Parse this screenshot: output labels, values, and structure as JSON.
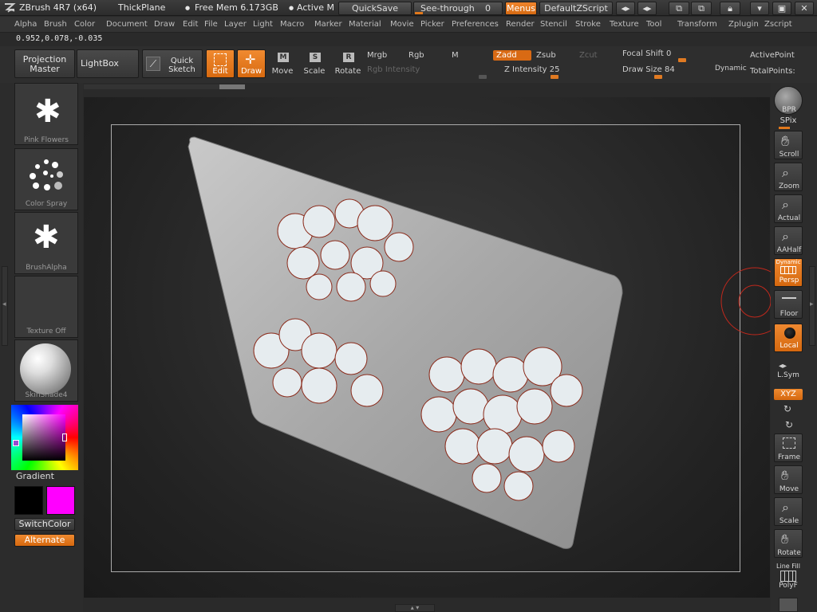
{
  "title": {
    "app": "ZBrush 4R7 (x64)",
    "document": "ThickPlane",
    "mem": "Free Mem 6.173GB",
    "active": "Active M",
    "quicksave": "QuickSave",
    "seethrough": "See-through",
    "seethrough_value": "0",
    "menus": "Menus",
    "zscript": "DefaultZScript"
  },
  "menu": [
    "Alpha",
    "Brush",
    "Color",
    "Document",
    "Draw",
    "Edit",
    "File",
    "Layer",
    "Light",
    "Macro",
    "Marker",
    "Material",
    "Movie",
    "Picker",
    "Preferences",
    "Render",
    "Stencil",
    "Stroke",
    "Texture",
    "Tool",
    "Transform",
    "Zplugin",
    "Zscript"
  ],
  "coords": "0.952,0.078,-0.035",
  "toolbar": {
    "projection_master": "Projection Master",
    "lightbox": "LightBox",
    "quick_sketch": "Quick Sketch",
    "edit": "Edit",
    "draw": "Draw",
    "move": "Move",
    "scale": "Scale",
    "rotate": "Rotate",
    "mrgb": "Mrgb",
    "rgb": "Rgb",
    "m": "M",
    "rgb_intensity": "Rgb Intensity",
    "zadd": "Zadd",
    "zsub": "Zsub",
    "zcut": "Zcut",
    "z_intensity": "Z Intensity 25",
    "focal_shift": "Focal Shift 0",
    "draw_size": "Draw Size 84",
    "dynamic": "Dynamic",
    "active_point": "ActivePoint",
    "total_points": "TotalPoints:"
  },
  "left": {
    "brush": "Pink Flowers",
    "stroke": "Color Spray",
    "alpha": "BrushAlpha",
    "texture": "Texture Off",
    "material": "SkinShade4",
    "gradient": "Gradient",
    "switch_color": "SwitchColor",
    "alternate": "Alternate",
    "main_color": "#ff00ff",
    "secondary_color": "#000000"
  },
  "right": {
    "bpr": "BPR",
    "spix": "SPix",
    "scroll": "Scroll",
    "zoom": "Zoom",
    "actual": "Actual",
    "aahalf": "AAHalf",
    "dynamic": "Dynamic",
    "persp": "Persp",
    "floor": "Floor",
    "local": "Local",
    "lsym": "L.Sym",
    "xyz": "XYZ",
    "frame": "Frame",
    "move": "Move",
    "scale": "Scale",
    "rotate": "Rotate",
    "line_fill": "Line Fill",
    "polyf": "PolyF"
  },
  "colors": {
    "accent": "#e0781c"
  }
}
